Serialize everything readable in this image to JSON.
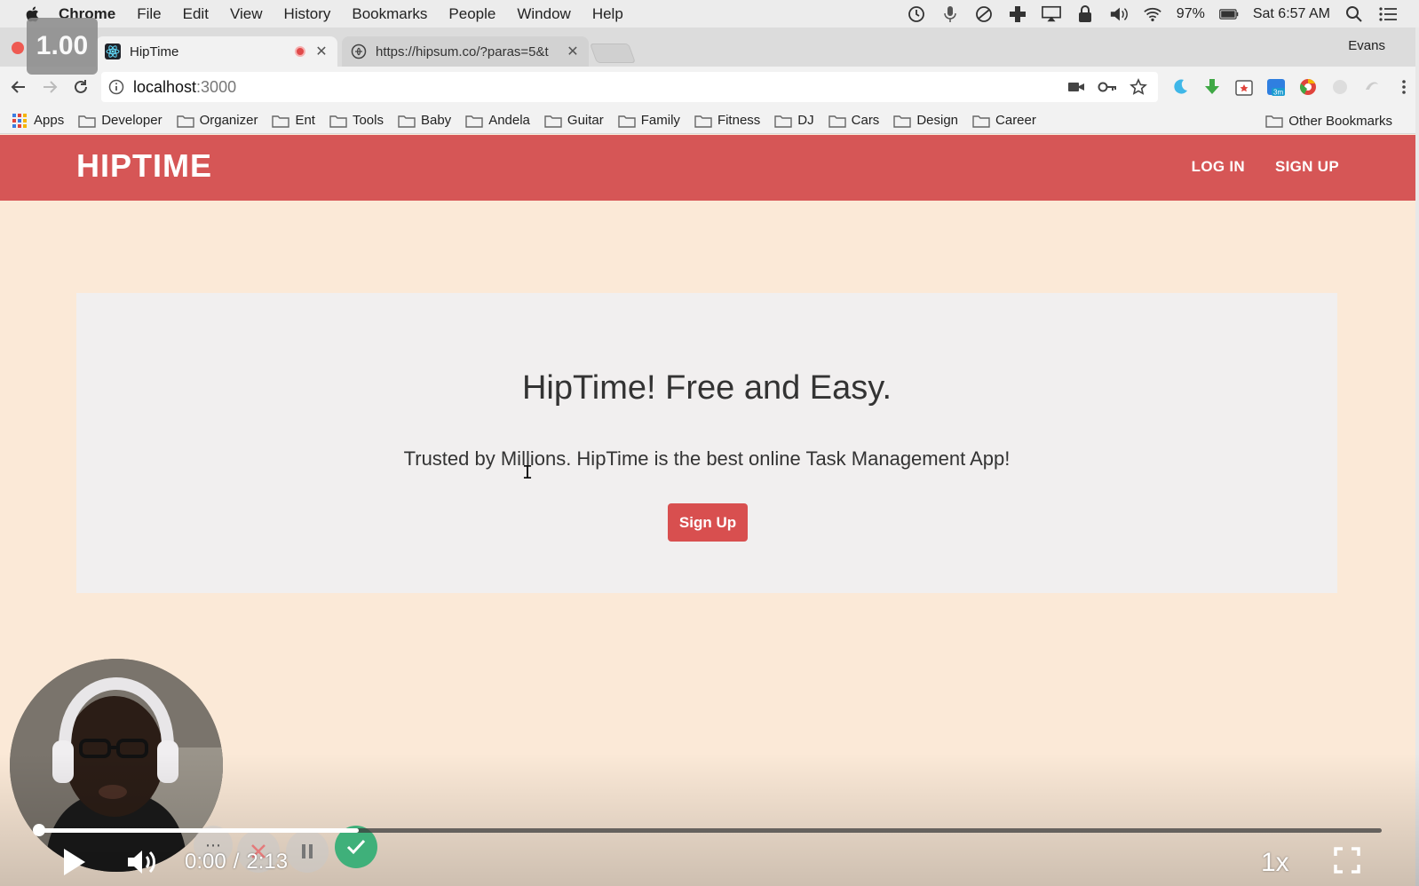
{
  "menubar": {
    "app": "Chrome",
    "items": [
      "File",
      "Edit",
      "View",
      "History",
      "Bookmarks",
      "People",
      "Window",
      "Help"
    ],
    "battery": "97%",
    "clock": "Sat 6:57 AM"
  },
  "zoom_badge": "1.00",
  "tabs": [
    {
      "title": "HipTime",
      "active": true
    },
    {
      "title": "https://hipsum.co/?paras=5&t",
      "active": false
    }
  ],
  "profile": "Evans",
  "omnibox": {
    "host": "localhost",
    "port": ":3000"
  },
  "bookmarks": {
    "apps_label": "Apps",
    "folders": [
      "Developer",
      "Organizer",
      "Ent",
      "Tools",
      "Baby",
      "Andela",
      "Guitar",
      "Family",
      "Fitness",
      "DJ",
      "Cars",
      "Design",
      "Career"
    ],
    "other": "Other Bookmarks"
  },
  "app": {
    "brand": "HIPTIME",
    "nav": {
      "login": "LOG IN",
      "signup": "SIGN UP"
    },
    "hero": {
      "title": "HipTime! Free and Easy.",
      "subtitle": "Trusted by Millions. HipTime is the best online Task Management App!",
      "cta": "Sign Up"
    },
    "colors": {
      "primary": "#d65656",
      "background": "#fbe9d7",
      "card": "#f1efef"
    }
  },
  "player": {
    "current_time": "0:00",
    "separator": "/",
    "duration": "2:13",
    "speed": "1x",
    "progress_fraction": 0.24
  },
  "icons": [
    "apple-icon",
    "search-icon",
    "wifi-icon",
    "volume-icon",
    "play-icon",
    "fullscreen-icon"
  ]
}
